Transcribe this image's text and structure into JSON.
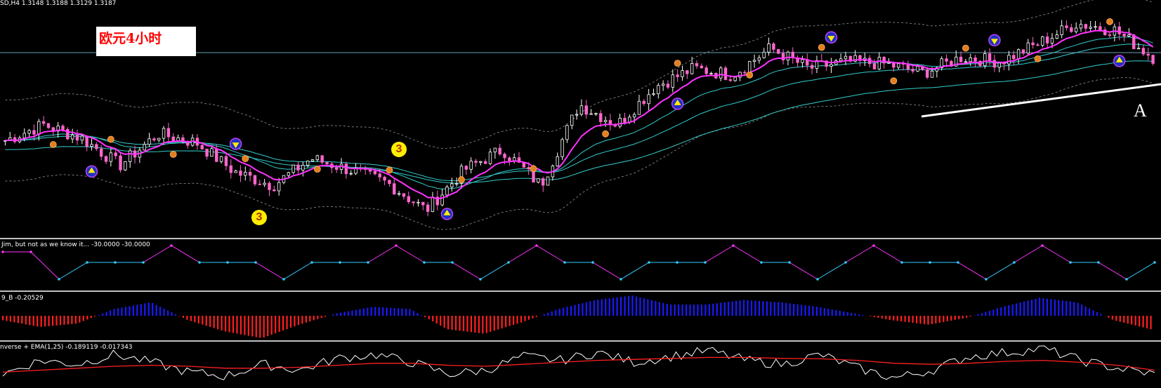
{
  "header": {
    "symbol_line": "SD,H4  1.3148 1.3188 1.3129 1.3187",
    "annotation": "欧元4小时",
    "corner_mark": "A",
    "wave_badges": [
      "3",
      "3"
    ]
  },
  "indicators": {
    "jim": {
      "title": "Jim, but not as we know it... -30.0000 -30.0000"
    },
    "histogram": {
      "title": "9_B -0.20529"
    },
    "inverse": {
      "title": "nverse + EMA(1,25) -0.189119 -0.017343"
    }
  },
  "colors": {
    "bull_candle": "#ffffff",
    "bear_candle": "#ff66cc",
    "fast_ma": "#ff33ff",
    "slow_ma": "#33cccc",
    "band": "#777777",
    "hist_pos": "#1a1aff",
    "hist_neg": "#ff2020",
    "jim_pink": "#ff33ff",
    "jim_cyan": "#33ccff",
    "ema_line": "#ff2020",
    "inverse_line": "#ffffff"
  },
  "chart_data": [
    {
      "type": "line",
      "title": "SD,H4",
      "xlabel": "",
      "ylabel": "",
      "x": [
        0,
        5,
        10,
        15,
        20,
        25,
        30,
        35,
        40,
        45,
        50,
        55,
        60,
        65,
        70,
        75,
        80,
        85,
        90,
        95,
        100,
        105,
        110,
        115,
        120,
        125,
        130,
        135,
        140,
        145,
        150
      ],
      "series": [
        {
          "name": "",
          "values": [
            0.42,
            0.49,
            0.43,
            0.31,
            0.45,
            0.41,
            0.28,
            0.22,
            0.34,
            0.29,
            0.23,
            0.11,
            0.29,
            0.38,
            0.22,
            0.58,
            0.49,
            0.66,
            0.74,
            0.71,
            0.83,
            0.74,
            0.77,
            0.76,
            0.72,
            0.79,
            0.77,
            0.85,
            0.94,
            0.91,
            0.79
          ]
        }
      ],
      "ylim": [
        0,
        1
      ]
    },
    {
      "type": "line",
      "title": "Jim, but not as we know it... -30.0000 -30.0000",
      "ylim": [
        0,
        1
      ],
      "x": [
        0,
        1,
        2,
        3,
        4,
        5,
        6,
        7,
        8,
        9,
        10,
        11,
        12,
        13,
        14,
        15,
        16,
        17,
        18,
        19,
        20,
        21,
        22,
        23,
        24,
        25,
        26,
        27,
        28,
        29,
        30,
        31,
        32,
        33,
        34,
        35,
        36,
        37,
        38,
        39,
        40,
        41
      ],
      "series": [
        {
          "name": "",
          "values": [
            0.85,
            0.85,
            0.2,
            0.6,
            0.6,
            0.6,
            1,
            0.6,
            0.6,
            0.6,
            0.2,
            0.6,
            0.6,
            0.6,
            1,
            0.6,
            0.6,
            0.2,
            0.6,
            1,
            0.6,
            0.6,
            0.2,
            0.6,
            0.6,
            0.6,
            1,
            0.6,
            0.6,
            0.2,
            0.6,
            1,
            0.6,
            0.6,
            0.6,
            0.2,
            0.6,
            1,
            0.6,
            0.6,
            0.2,
            0.6
          ]
        }
      ]
    },
    {
      "type": "bar",
      "title": "9_B -0.20529",
      "x": [
        0,
        5,
        10,
        15,
        20,
        25,
        30,
        35,
        40,
        45,
        50,
        55,
        60,
        65,
        70,
        75,
        80,
        85,
        90,
        95,
        100,
        105,
        110,
        115,
        120,
        125,
        130,
        135,
        140,
        145,
        150,
        155
      ],
      "values": [
        -0.2,
        -0.5,
        -0.35,
        0.3,
        0.6,
        -0.2,
        -0.7,
        -1,
        -0.4,
        0.1,
        0.4,
        0.3,
        -0.6,
        -0.8,
        -0.3,
        0.3,
        0.7,
        0.9,
        0.5,
        0.5,
        0.7,
        0.6,
        0.4,
        0.1,
        -0.2,
        -0.4,
        -0.1,
        0.4,
        0.8,
        0.6,
        -0.2,
        -0.6
      ],
      "ylim": [
        -1,
        1
      ]
    },
    {
      "type": "line",
      "title": "nverse + EMA(1,25) -0.189119 -0.017343",
      "x": [
        0,
        5,
        10,
        15,
        20,
        25,
        30,
        35,
        40,
        45,
        50,
        55,
        60,
        65,
        70,
        75,
        80,
        85,
        90,
        95,
        100,
        105,
        110,
        115,
        120,
        125,
        130,
        135,
        140,
        145,
        150,
        155
      ],
      "series": [
        {
          "name": "",
          "values": [
            -0.4,
            0.3,
            0.1,
            0.6,
            0.2,
            -0.3,
            -0.5,
            0.1,
            -0.2,
            0.4,
            0.6,
            0.2,
            -0.4,
            -0.2,
            0.5,
            0.3,
            0.7,
            0.2,
            0.5,
            0.8,
            0.3,
            0.1,
            0.6,
            -0.1,
            -0.6,
            -0.2,
            0.5,
            0.7,
            0.9,
            0.3,
            -0.1,
            -0.4
          ]
        },
        {
          "name": "",
          "values": [
            -0.3,
            -0.2,
            -0.1,
            0,
            0.05,
            0,
            -0.1,
            -0.1,
            -0.05,
            0.05,
            0.15,
            0.15,
            0.05,
            0,
            0.1,
            0.2,
            0.3,
            0.35,
            0.4,
            0.45,
            0.45,
            0.4,
            0.38,
            0.3,
            0.15,
            0.1,
            0.15,
            0.25,
            0.3,
            0.2,
            0.05,
            -0.2
          ]
        }
      ],
      "ylim": [
        -1,
        1
      ]
    }
  ]
}
